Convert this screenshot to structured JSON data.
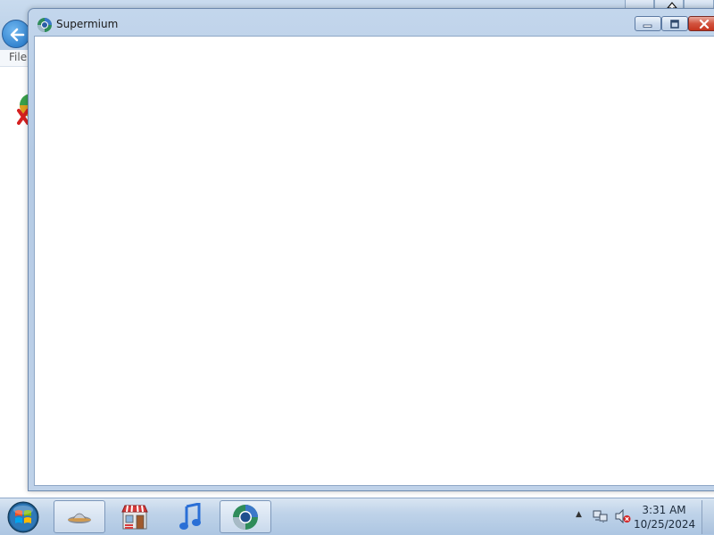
{
  "background_window": {
    "menu_file": "File",
    "back_icon": "back-arrow-icon"
  },
  "main_window": {
    "title": "Supermium",
    "icon": "supermium-logo-icon",
    "buttons": {
      "minimize": "minimize-icon",
      "maximize": "maximize-icon",
      "close": "close-icon"
    }
  },
  "taskbar": {
    "start": "windows-start-orb",
    "pinned": [
      {
        "name": "ufo-app-icon",
        "active": true
      },
      {
        "name": "store-icon",
        "active": false
      },
      {
        "name": "itunes-music-icon",
        "active": false
      },
      {
        "name": "supermium-logo-icon",
        "active": true
      }
    ],
    "tray": {
      "time": "3:31 AM",
      "date": "10/25/2024"
    }
  }
}
